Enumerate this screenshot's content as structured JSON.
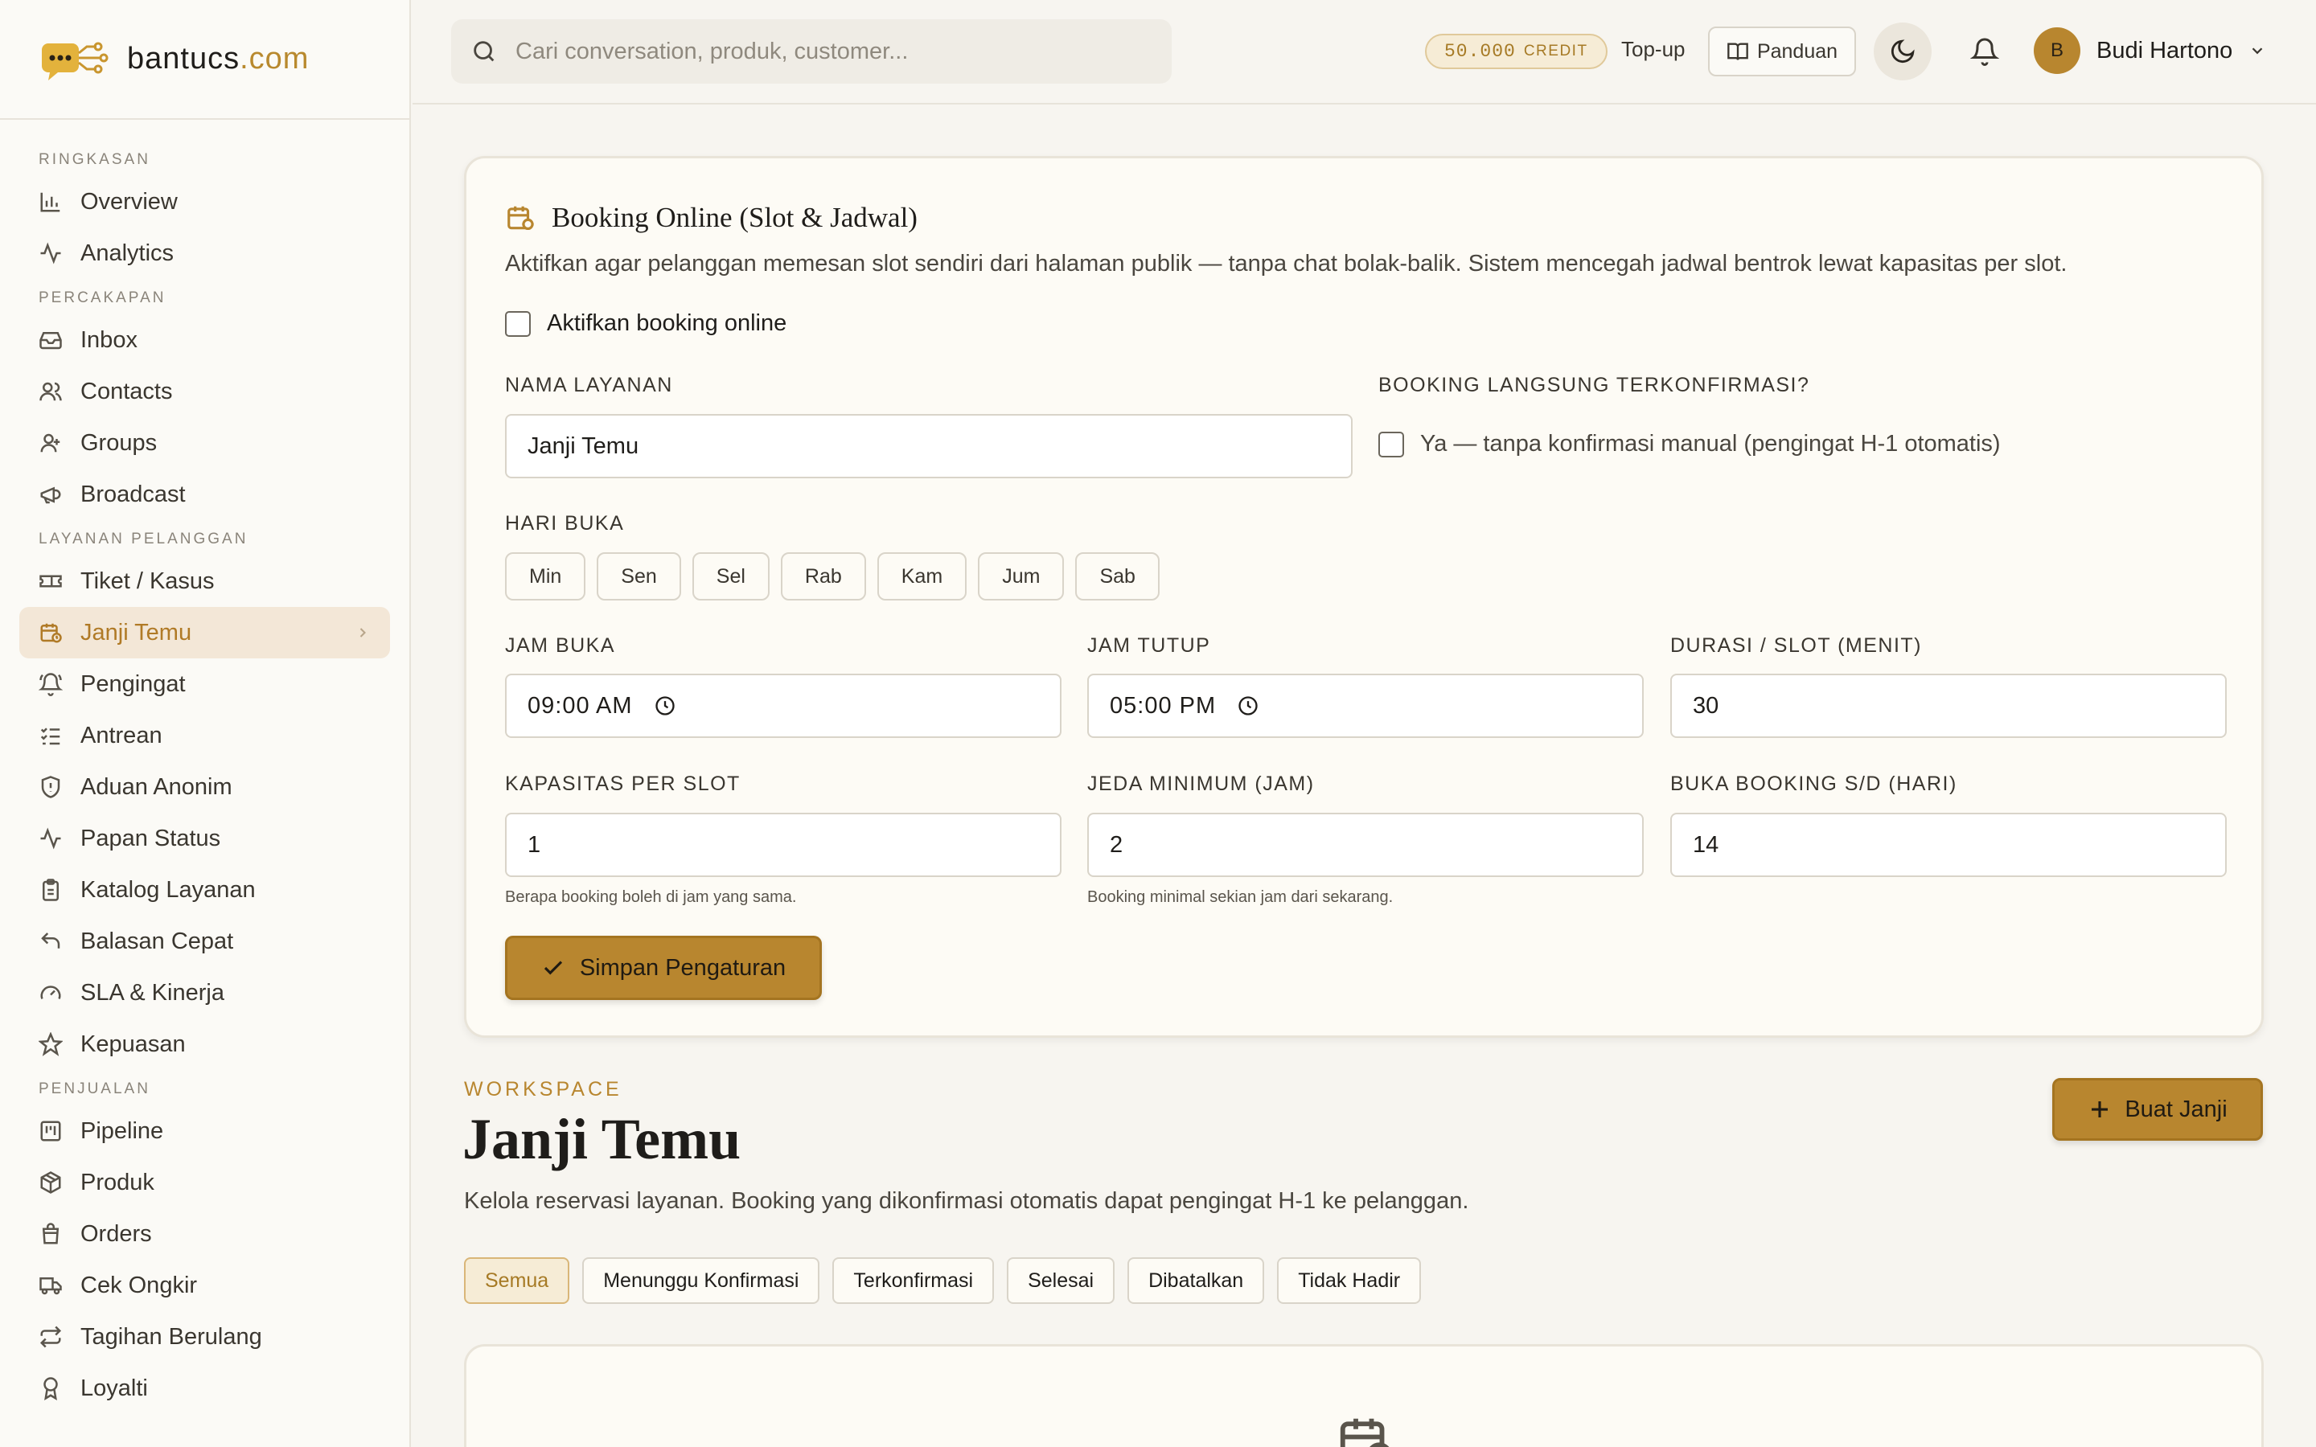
{
  "brand": {
    "name": "bantucs",
    "tld": ".com"
  },
  "sidebar": {
    "groups": [
      {
        "label": "RINGKASAN",
        "items": [
          {
            "label": "Overview",
            "icon": "bar-chart-icon"
          },
          {
            "label": "Analytics",
            "icon": "activity-icon"
          }
        ]
      },
      {
        "label": "PERCAKAPAN",
        "items": [
          {
            "label": "Inbox",
            "icon": "inbox-icon"
          },
          {
            "label": "Contacts",
            "icon": "users-icon"
          },
          {
            "label": "Groups",
            "icon": "group-icon"
          },
          {
            "label": "Broadcast",
            "icon": "megaphone-icon"
          }
        ]
      },
      {
        "label": "LAYANAN PELANGGAN",
        "items": [
          {
            "label": "Tiket / Kasus",
            "icon": "ticket-icon"
          },
          {
            "label": "Janji Temu",
            "icon": "calendar-clock-icon",
            "active": true
          },
          {
            "label": "Pengingat",
            "icon": "bell-ring-icon"
          },
          {
            "label": "Antrean",
            "icon": "list-checks-icon"
          },
          {
            "label": "Aduan Anonim",
            "icon": "shield-icon"
          },
          {
            "label": "Papan Status",
            "icon": "pulse-icon"
          },
          {
            "label": "Katalog Layanan",
            "icon": "clipboard-icon"
          },
          {
            "label": "Balasan Cepat",
            "icon": "reply-icon"
          },
          {
            "label": "SLA & Kinerja",
            "icon": "gauge-icon"
          },
          {
            "label": "Kepuasan",
            "icon": "star-icon"
          }
        ]
      },
      {
        "label": "PENJUALAN",
        "items": [
          {
            "label": "Pipeline",
            "icon": "kanban-icon"
          },
          {
            "label": "Produk",
            "icon": "package-icon"
          },
          {
            "label": "Orders",
            "icon": "shopping-bag-icon"
          },
          {
            "label": "Cek Ongkir",
            "icon": "truck-icon"
          },
          {
            "label": "Tagihan Berulang",
            "icon": "repeat-icon"
          },
          {
            "label": "Loyalti",
            "icon": "award-icon"
          }
        ]
      }
    ]
  },
  "topbar": {
    "search_placeholder": "Cari conversation, produk, customer...",
    "credit_amount": "50.000",
    "credit_label": "CREDIT",
    "topup_label": "Top-up",
    "guide_label": "Panduan",
    "user_initial": "B",
    "user_name": "Budi Hartono"
  },
  "booking": {
    "title": "Booking Online (Slot & Jadwal)",
    "description": "Aktifkan agar pelanggan memesan slot sendiri dari halaman publik — tanpa chat bolak-balik. Sistem mencegah jadwal bentrok lewat kapasitas per slot.",
    "enable_label": "Aktifkan booking online",
    "service_name_label": "NAMA LAYANAN",
    "service_name_value": "Janji Temu",
    "auto_confirm_label": "BOOKING LANGSUNG TERKONFIRMASI?",
    "auto_confirm_option": "Ya — tanpa konfirmasi manual (pengingat H-1 otomatis)",
    "open_days_label": "HARI BUKA",
    "days": [
      "Min",
      "Sen",
      "Sel",
      "Rab",
      "Kam",
      "Jum",
      "Sab"
    ],
    "open_time_label": "JAM BUKA",
    "open_time_value": "09:00 AM",
    "close_time_label": "JAM TUTUP",
    "close_time_value": "05:00 PM",
    "duration_label": "DURASI / SLOT (MENIT)",
    "duration_value": "30",
    "capacity_label": "KAPASITAS PER SLOT",
    "capacity_value": "1",
    "capacity_hint": "Berapa booking boleh di jam yang sama.",
    "min_gap_label": "JEDA MINIMUM (JAM)",
    "min_gap_value": "2",
    "min_gap_hint": "Booking minimal sekian jam dari sekarang.",
    "open_until_label": "BUKA BOOKING S/D (HARI)",
    "open_until_value": "14",
    "save_label": "Simpan Pengaturan"
  },
  "workspace": {
    "eyebrow": "WORKSPACE",
    "title": "Janji Temu",
    "description": "Kelola reservasi layanan. Booking yang dikonfirmasi otomatis dapat pengingat H-1 ke pelanggan.",
    "new_label": "Buat Janji",
    "tabs": [
      "Semua",
      "Menunggu Konfirmasi",
      "Terkonfirmasi",
      "Selesai",
      "Dibatalkan",
      "Tidak Hadir"
    ]
  },
  "colors": {
    "accent": "#b8862f",
    "background": "#f7f5f0",
    "card": "#fdfbf5"
  }
}
